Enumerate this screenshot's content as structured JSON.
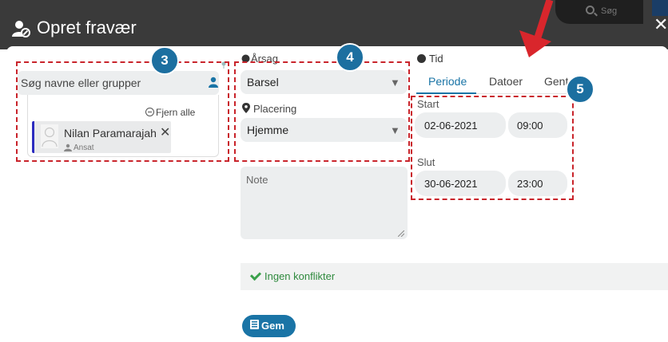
{
  "dialog": {
    "title": "Opret fravær",
    "close_label": "✕"
  },
  "topbar": {
    "search_text": "Søg"
  },
  "people": {
    "search_placeholder": "Søg navne eller grupper",
    "remove_all_label": "Fjern alle",
    "selected": [
      {
        "name": "Nilan Paramarajah",
        "role": "Ansat"
      }
    ]
  },
  "reason": {
    "label": "Årsag",
    "value": "Barsel"
  },
  "location": {
    "label": "Placering",
    "value": "Hjemme"
  },
  "note": {
    "placeholder": "Note"
  },
  "time": {
    "label": "Tid",
    "tabs": [
      "Periode",
      "Datoer",
      "Gentaget"
    ],
    "active_tab": "Periode",
    "start_label": "Start",
    "start_date": "02-06-2021",
    "start_time": "09:00",
    "end_label": "Slut",
    "end_date": "30-06-2021",
    "end_time": "23:00"
  },
  "conflicts": {
    "text": "Ingen konflikter"
  },
  "save": {
    "label": "Gem"
  },
  "callouts": [
    "3",
    "4",
    "5"
  ],
  "colors": {
    "accent": "#1a74a6",
    "callout_dash": "#c9242b",
    "badge": "#1c6fa0",
    "success": "#3aa14b",
    "header": "#3a3a3a"
  },
  "icons": {
    "title": "user-absence-icon",
    "search_person": "person-icon",
    "reason": "reason-icon",
    "location": "location-pin-icon",
    "time": "clock-icon",
    "check": "check-icon",
    "save": "save-icon"
  }
}
